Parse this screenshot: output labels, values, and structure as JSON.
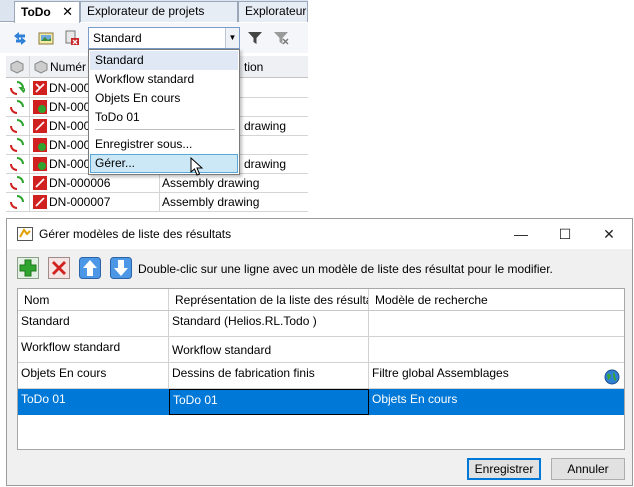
{
  "tabs": [
    {
      "label": "ToDo",
      "close": "✕",
      "active": true
    },
    {
      "label": "Explorateur de projets"
    },
    {
      "label": "Explorateur"
    }
  ],
  "toolbar": {
    "view_select_value": "Standard",
    "icons": [
      "sync-icon",
      "document-image-icon",
      "delete-document-icon",
      "filter-icon",
      "clear-filter-icon"
    ]
  },
  "grid": {
    "header_col1": "Numér",
    "header_col2": "tion",
    "rows": [
      {
        "number": "DN-0000",
        "description": ""
      },
      {
        "number": "DN-0000",
        "description": ""
      },
      {
        "number": "DN-0000",
        "description": "drawing"
      },
      {
        "number": "DN-0000",
        "description": ""
      },
      {
        "number": "DN-0000",
        "description": "drawing"
      },
      {
        "number": "DN-000006",
        "description": "Assembly drawing"
      },
      {
        "number": "DN-000007",
        "description": "Assembly drawing"
      }
    ]
  },
  "dropdown": {
    "items": [
      "Standard",
      "Workflow standard",
      "Objets En cours",
      "ToDo 01"
    ],
    "save_as": "Enregistrer sous...",
    "manage": "Gérer..."
  },
  "dialog": {
    "title": "Gérer modèles de liste des résultats",
    "hint": "Double-clic sur une ligne avec un modèle de liste des résultat pour le modifier.",
    "columns": [
      "Nom",
      "Représentation de la liste des résulta",
      "Modèle de recherche"
    ],
    "rows": [
      {
        "name": "Standard",
        "representation": "Standard (Helios.RL.Todo )",
        "search": ""
      },
      {
        "name": "Workflow standard",
        "representation": "Workflow standard",
        "search": ""
      },
      {
        "name": "Objets En cours",
        "representation": "Dessins de fabrication finis",
        "search": "Filtre global Assemblages"
      },
      {
        "name": "ToDo 01",
        "representation": "ToDo 01",
        "search": "Objets En cours"
      }
    ],
    "save_button": "Enregistrer",
    "cancel_button": "Annuler",
    "minimize": "—",
    "maximize": "☐",
    "close": "✕"
  },
  "colors": {
    "selection": "#0078d7",
    "hover": "#cce8f7",
    "add_green": "#2fa52f",
    "delete_red": "#d02020",
    "arrow_blue": "#2e7fd6"
  }
}
